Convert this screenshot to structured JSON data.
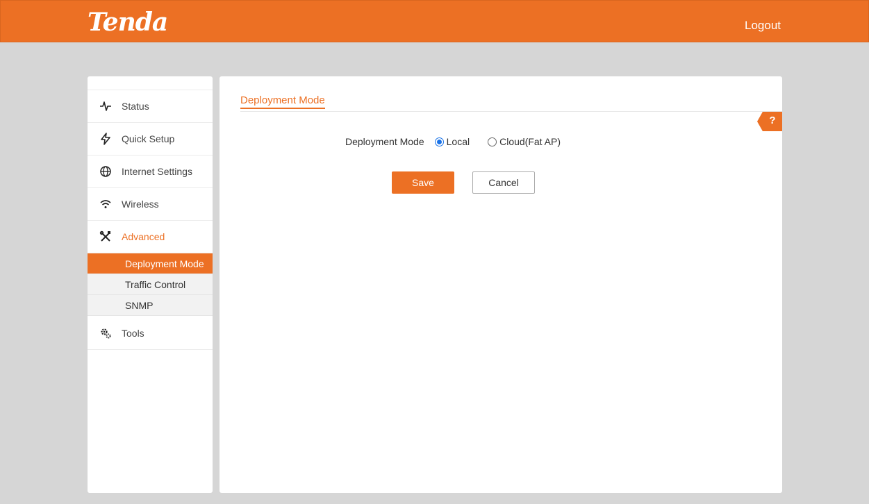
{
  "header": {
    "logo_text": "Tenda",
    "logout_label": "Logout"
  },
  "sidebar": {
    "items": [
      {
        "label": "Status",
        "icon": "pulse-icon"
      },
      {
        "label": "Quick Setup",
        "icon": "lightning-icon"
      },
      {
        "label": "Internet Settings",
        "icon": "globe-icon"
      },
      {
        "label": "Wireless",
        "icon": "wifi-icon"
      },
      {
        "label": "Advanced",
        "icon": "tools-cross-icon",
        "active": true
      },
      {
        "label": "Tools",
        "icon": "gears-icon"
      }
    ],
    "sub_items": [
      {
        "label": "Deployment Mode",
        "selected": true
      },
      {
        "label": "Traffic Control"
      },
      {
        "label": "SNMP"
      }
    ]
  },
  "content": {
    "tab_title": "Deployment Mode",
    "help_label": "?",
    "form": {
      "label": "Deployment Mode",
      "options": [
        {
          "label": "Local",
          "checked": true
        },
        {
          "label": "Cloud(Fat AP)",
          "checked": false
        }
      ]
    },
    "save_label": "Save",
    "cancel_label": "Cancel"
  },
  "colors": {
    "accent": "#ec7024",
    "background": "#d6d6d6",
    "radio_selected": "#1a73e8"
  }
}
